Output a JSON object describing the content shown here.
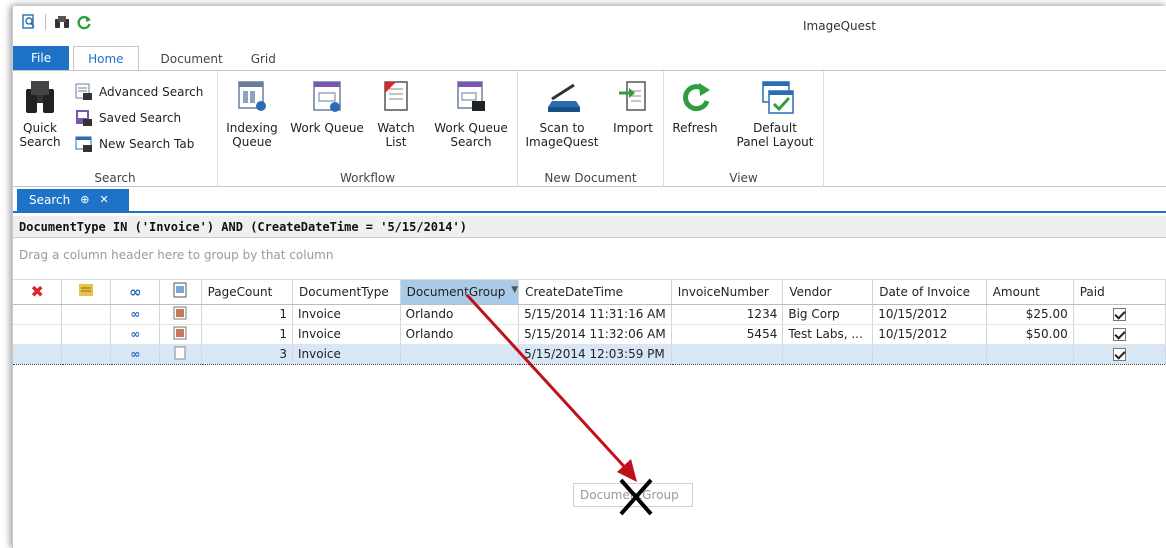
{
  "app": {
    "title": "ImageQuest"
  },
  "quick_access": {
    "icons": [
      "search-doc-icon",
      "binoculars-icon",
      "refresh-icon"
    ]
  },
  "ribbon": {
    "tabs": [
      {
        "label": "File"
      },
      {
        "label": "Home"
      },
      {
        "label": "Document"
      },
      {
        "label": "Grid"
      }
    ],
    "groups": {
      "search": {
        "label": "Search",
        "quick_search": "Quick\nSearch",
        "advanced_search": "Advanced Search",
        "saved_search": "Saved Search",
        "new_search_tab": "New Search Tab"
      },
      "workflow": {
        "label": "Workflow",
        "indexing_queue": "Indexing\nQueue",
        "work_queue": "Work Queue",
        "watch_list": "Watch\nList",
        "work_queue_search": "Work Queue\nSearch"
      },
      "new_document": {
        "label": "New Document",
        "scan": "Scan to\nImageQuest",
        "import": "Import"
      },
      "view": {
        "label": "View",
        "refresh": "Refresh",
        "default_layout": "Default\nPanel Layout"
      }
    }
  },
  "doc_tab": {
    "label": "Search"
  },
  "filter": "DocumentType IN ('Invoice') AND (CreateDateTime = '5/15/2014')",
  "group_panel": "Drag a column header here to group by that column",
  "grid": {
    "columns": [
      "PageCount",
      "DocumentType",
      "DocumentGroup",
      "CreateDateTime",
      "InvoiceNumber",
      "Vendor",
      "Date of Invoice",
      "Amount",
      "Paid"
    ],
    "rows": [
      {
        "pagecount": "1",
        "doctype": "Invoice",
        "group": "Orlando",
        "created": "5/15/2014 11:31:16 AM",
        "invoice": "1234",
        "vendor": "Big Corp",
        "date": "10/15/2012",
        "amount": "$25.00",
        "paid": true
      },
      {
        "pagecount": "1",
        "doctype": "Invoice",
        "group": "Orlando",
        "created": "5/15/2014 11:32:06 AM",
        "invoice": "5454",
        "vendor": "Test Labs, ...",
        "date": "10/15/2012",
        "amount": "$50.00",
        "paid": true
      },
      {
        "pagecount": "3",
        "doctype": "Invoice",
        "group": "",
        "created": "5/15/2014 12:03:59 PM",
        "invoice": "",
        "vendor": "",
        "date": "",
        "amount": "",
        "paid": true
      }
    ]
  },
  "drag_ghost": "DocumentGroup",
  "colors": {
    "accent": "#1e73c9",
    "arrow": "#c0111a",
    "sorted_header": "#a9cbe8"
  }
}
